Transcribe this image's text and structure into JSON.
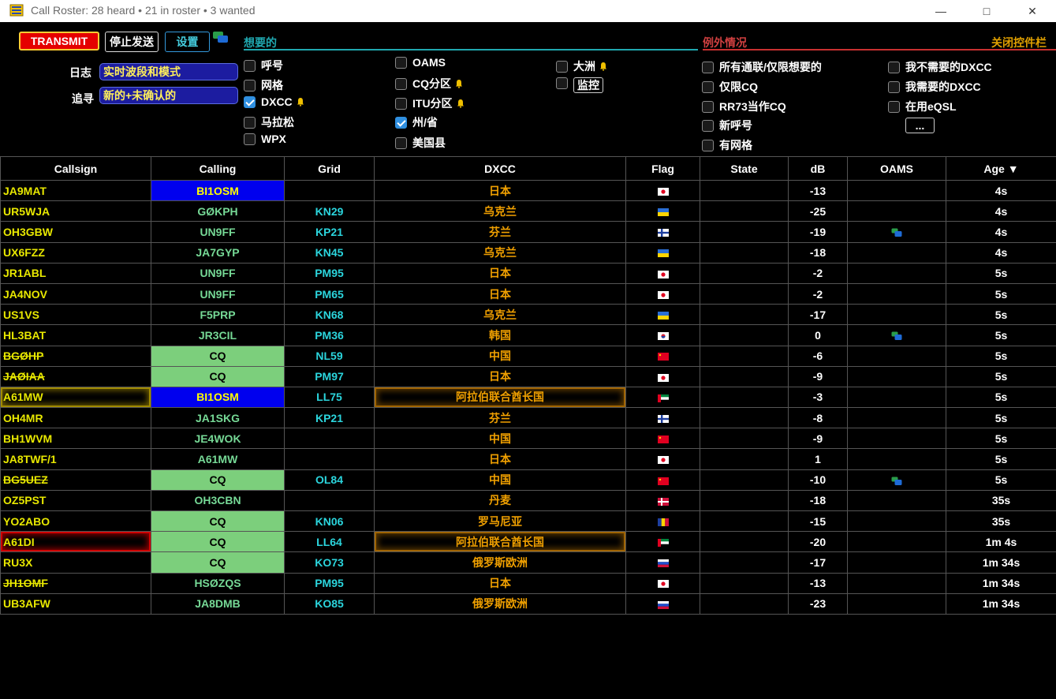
{
  "window": {
    "title": "Call Roster: 28 heard • 21 in roster • 3 wanted",
    "minimize_glyph": "—",
    "maximize_glyph": "□",
    "close_glyph": "✕"
  },
  "controls": {
    "transmit_label": "TRANSMIT",
    "halt_label": "停止发送",
    "settings_label": "设置",
    "log_label": "日志",
    "log_value": "实时波段和模式",
    "hunt_label": "追寻",
    "hunt_value": "新的+未确认的",
    "wanted_title": "想要的",
    "exceptions_title": "例外情况",
    "close_controls_label": "关闭控件栏",
    "more_label": "...",
    "wanted_options": [
      {
        "label": "呼号",
        "checked": false,
        "bell": false
      },
      {
        "label": "网格",
        "checked": false,
        "bell": false
      },
      {
        "label": "DXCC",
        "checked": true,
        "bell": true
      },
      {
        "label": "马拉松",
        "checked": false,
        "bell": false
      },
      {
        "label": "WPX",
        "checked": false,
        "bell": false
      },
      {
        "label": "OAMS",
        "checked": false,
        "bell": false
      },
      {
        "label": "CQ分区",
        "checked": false,
        "bell": true
      },
      {
        "label": "ITU分区",
        "checked": false,
        "bell": true
      },
      {
        "label": "州/省",
        "checked": true,
        "bell": false
      },
      {
        "label": "美国县",
        "checked": false,
        "bell": false
      },
      {
        "label": "大洲",
        "checked": false,
        "bell": true
      },
      {
        "label": "监控",
        "checked": false,
        "bell": false
      }
    ],
    "exception_options": [
      {
        "label": "所有通联/仅限想要的",
        "checked": false
      },
      {
        "label": "仅限CQ",
        "checked": false
      },
      {
        "label": "RR73当作CQ",
        "checked": false
      },
      {
        "label": "新呼号",
        "checked": false
      },
      {
        "label": "有网格",
        "checked": false
      },
      {
        "label": "我不需要的DXCC",
        "checked": false
      },
      {
        "label": "我需要的DXCC",
        "checked": false
      },
      {
        "label": "在用eQSL",
        "checked": false
      }
    ],
    "colors": {
      "wanted": "#20a8b0",
      "exceptions": "#c83030",
      "close": "#e0a000"
    }
  },
  "table": {
    "headers": [
      "Callsign",
      "Calling",
      "Grid",
      "DXCC",
      "Flag",
      "State",
      "dB",
      "OAMS",
      "Age ▼"
    ],
    "rows": [
      {
        "callsign": "JA9MAT",
        "calling": "BI1OSM",
        "grid": "",
        "dxcc": "日本",
        "flag": "jp",
        "state": "",
        "db": "-13",
        "oams": false,
        "age": "4s",
        "calling_style": "blue",
        "strike": false,
        "call_style": "",
        "dxcc_style": ""
      },
      {
        "callsign": "UR5WJA",
        "calling": "GØKPH",
        "grid": "KN29",
        "dxcc": "乌克兰",
        "flag": "ua",
        "state": "",
        "db": "-25",
        "oams": false,
        "age": "4s",
        "calling_style": "",
        "strike": false,
        "call_style": "",
        "dxcc_style": ""
      },
      {
        "callsign": "OH3GBW",
        "calling": "UN9FF",
        "grid": "KP21",
        "dxcc": "芬兰",
        "flag": "fi",
        "state": "",
        "db": "-19",
        "oams": true,
        "age": "4s",
        "calling_style": "",
        "strike": false,
        "call_style": "",
        "dxcc_style": ""
      },
      {
        "callsign": "UX6FZZ",
        "calling": "JA7GYP",
        "grid": "KN45",
        "dxcc": "乌克兰",
        "flag": "ua",
        "state": "",
        "db": "-18",
        "oams": false,
        "age": "4s",
        "calling_style": "",
        "strike": false,
        "call_style": "",
        "dxcc_style": ""
      },
      {
        "callsign": "JR1ABL",
        "calling": "UN9FF",
        "grid": "PM95",
        "dxcc": "日本",
        "flag": "jp",
        "state": "",
        "db": "-2",
        "oams": false,
        "age": "5s",
        "calling_style": "",
        "strike": false,
        "call_style": "",
        "dxcc_style": ""
      },
      {
        "callsign": "JA4NOV",
        "calling": "UN9FF",
        "grid": "PM65",
        "dxcc": "日本",
        "flag": "jp",
        "state": "",
        "db": "-2",
        "oams": false,
        "age": "5s",
        "calling_style": "",
        "strike": false,
        "call_style": "",
        "dxcc_style": ""
      },
      {
        "callsign": "US1VS",
        "calling": "F5PRP",
        "grid": "KN68",
        "dxcc": "乌克兰",
        "flag": "ua",
        "state": "",
        "db": "-17",
        "oams": false,
        "age": "5s",
        "calling_style": "",
        "strike": false,
        "call_style": "",
        "dxcc_style": ""
      },
      {
        "callsign": "HL3BAT",
        "calling": "JR3CIL",
        "grid": "PM36",
        "dxcc": "韩国",
        "flag": "kr",
        "state": "",
        "db": "0",
        "oams": true,
        "age": "5s",
        "calling_style": "",
        "strike": false,
        "call_style": "",
        "dxcc_style": ""
      },
      {
        "callsign": "BGØHP",
        "calling": "CQ",
        "grid": "NL59",
        "dxcc": "中国",
        "flag": "cn",
        "state": "",
        "db": "-6",
        "oams": false,
        "age": "5s",
        "calling_style": "green",
        "strike": true,
        "call_style": "",
        "dxcc_style": ""
      },
      {
        "callsign": "JAØIAA",
        "calling": "CQ",
        "grid": "PM97",
        "dxcc": "日本",
        "flag": "jp",
        "state": "",
        "db": "-9",
        "oams": false,
        "age": "5s",
        "calling_style": "green",
        "strike": true,
        "call_style": "",
        "dxcc_style": ""
      },
      {
        "callsign": "A61MW",
        "calling": "BI1OSM",
        "grid": "LL75",
        "dxcc": "阿拉伯联合酋长国",
        "flag": "ae",
        "state": "",
        "db": "-3",
        "oams": false,
        "age": "5s",
        "calling_style": "blue",
        "strike": false,
        "call_style": "glow-y",
        "dxcc_style": "glow-o"
      },
      {
        "callsign": "OH4MR",
        "calling": "JA1SKG",
        "grid": "KP21",
        "dxcc": "芬兰",
        "flag": "fi",
        "state": "",
        "db": "-8",
        "oams": false,
        "age": "5s",
        "calling_style": "",
        "strike": false,
        "call_style": "",
        "dxcc_style": ""
      },
      {
        "callsign": "BH1WVM",
        "calling": "JE4WOK",
        "grid": "",
        "dxcc": "中国",
        "flag": "cn",
        "state": "",
        "db": "-9",
        "oams": false,
        "age": "5s",
        "calling_style": "",
        "strike": false,
        "call_style": "",
        "dxcc_style": ""
      },
      {
        "callsign": "JA8TWF/1",
        "calling": "A61MW",
        "grid": "",
        "dxcc": "日本",
        "flag": "jp",
        "state": "",
        "db": "1",
        "oams": false,
        "age": "5s",
        "calling_style": "",
        "strike": false,
        "call_style": "",
        "dxcc_style": ""
      },
      {
        "callsign": "BG5UEZ",
        "calling": "CQ",
        "grid": "OL84",
        "dxcc": "中国",
        "flag": "cn",
        "state": "",
        "db": "-10",
        "oams": true,
        "age": "5s",
        "calling_style": "green",
        "strike": true,
        "call_style": "",
        "dxcc_style": ""
      },
      {
        "callsign": "OZ5PST",
        "calling": "OH3CBN",
        "grid": "",
        "dxcc": "丹麦",
        "flag": "dk",
        "state": "",
        "db": "-18",
        "oams": false,
        "age": "35s",
        "calling_style": "",
        "strike": false,
        "call_style": "",
        "dxcc_style": ""
      },
      {
        "callsign": "YO2ABO",
        "calling": "CQ",
        "grid": "KN06",
        "dxcc": "罗马尼亚",
        "flag": "ro",
        "state": "",
        "db": "-15",
        "oams": false,
        "age": "35s",
        "calling_style": "green",
        "strike": false,
        "call_style": "",
        "dxcc_style": ""
      },
      {
        "callsign": "A61DI",
        "calling": "CQ",
        "grid": "LL64",
        "dxcc": "阿拉伯联合酋长国",
        "flag": "ae",
        "state": "",
        "db": "-20",
        "oams": false,
        "age": "1m 4s",
        "calling_style": "green",
        "strike": false,
        "call_style": "glow-r",
        "dxcc_style": "glow-o"
      },
      {
        "callsign": "RU3X",
        "calling": "CQ",
        "grid": "KO73",
        "dxcc": "俄罗斯欧洲",
        "flag": "ru",
        "state": "",
        "db": "-17",
        "oams": false,
        "age": "1m 34s",
        "calling_style": "green",
        "strike": false,
        "call_style": "",
        "dxcc_style": ""
      },
      {
        "callsign": "JH1OMF",
        "calling": "HSØZQS",
        "grid": "PM95",
        "dxcc": "日本",
        "flag": "jp",
        "state": "",
        "db": "-13",
        "oams": false,
        "age": "1m 34s",
        "calling_style": "",
        "strike": true,
        "call_style": "",
        "dxcc_style": ""
      },
      {
        "callsign": "UB3AFW",
        "calling": "JA8DMB",
        "grid": "KO85",
        "dxcc": "俄罗斯欧洲",
        "flag": "ru",
        "state": "",
        "db": "-23",
        "oams": false,
        "age": "1m 34s",
        "calling_style": "",
        "strike": false,
        "call_style": "",
        "dxcc_style": ""
      }
    ]
  }
}
